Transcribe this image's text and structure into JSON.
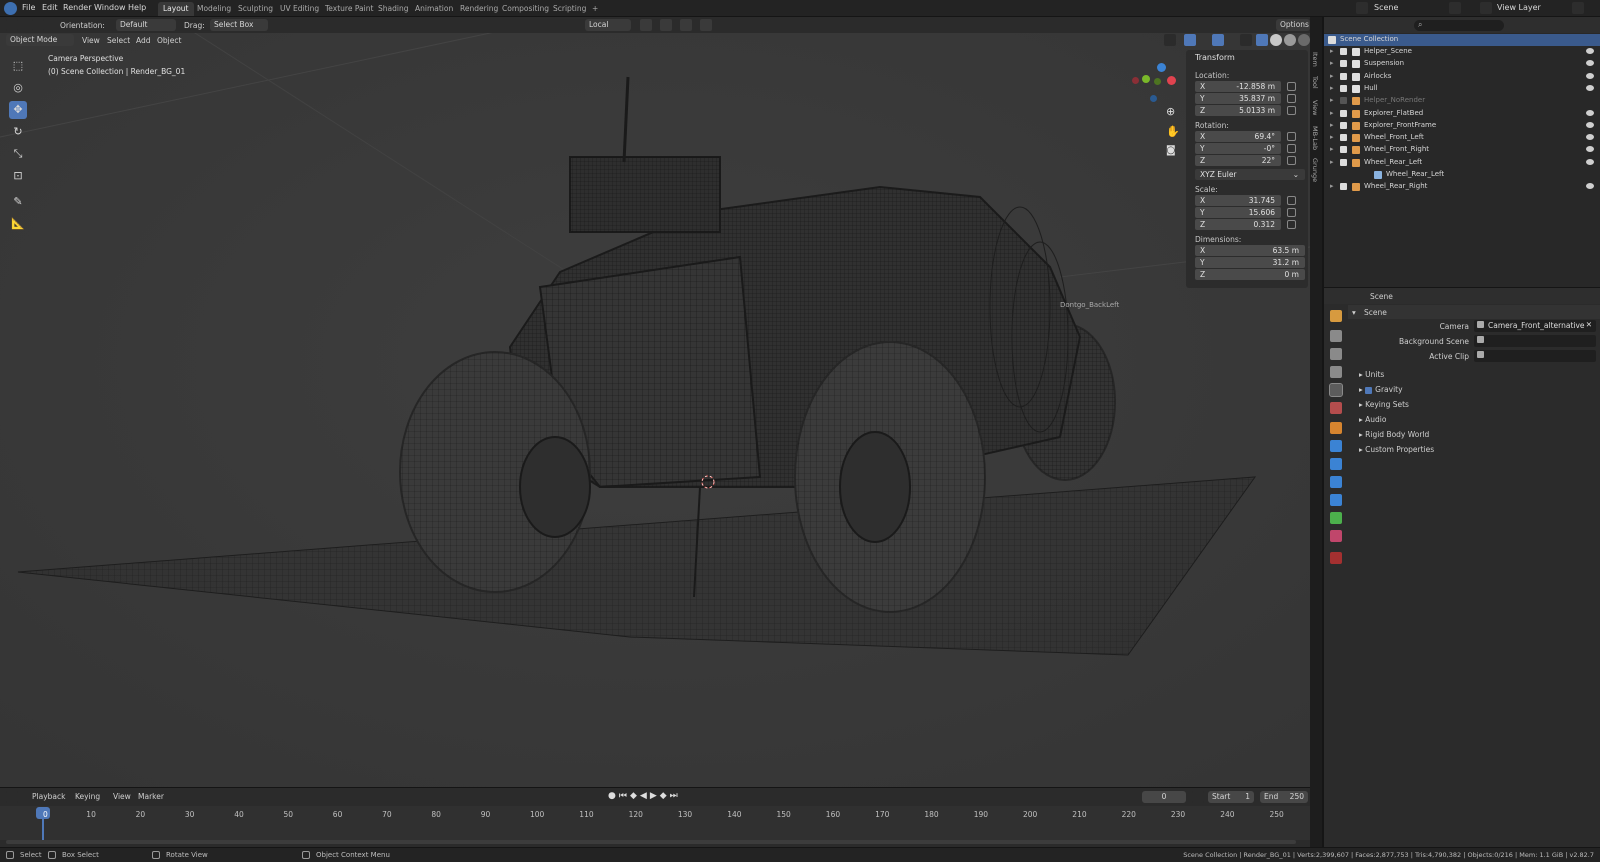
{
  "menu": {
    "items": [
      "File",
      "Edit",
      "Render",
      "Window",
      "Help"
    ],
    "workspaces": [
      "Layout",
      "Modeling",
      "Sculpting",
      "UV Editing",
      "Texture Paint",
      "Shading",
      "Animation",
      "Rendering",
      "Compositing",
      "Scripting"
    ],
    "active_workspace": "Layout",
    "add_tab": "+",
    "scene_name": "Scene",
    "view_layer": "View Layer"
  },
  "viewport_header": {
    "orientation_label": "Orientation:",
    "orientation_value": "Default",
    "drag_label": "Drag:",
    "drag_value": "Select Box",
    "transform_space": "Local",
    "options": "Options",
    "mode": "Object Mode",
    "menus": [
      "View",
      "Select",
      "Add",
      "Object"
    ]
  },
  "viewport": {
    "title": "Camera Perspective",
    "subtitle": "(0) Scene Collection | Render_BG_01",
    "overlay_label": "Dontgo_BackLeft"
  },
  "npanel": {
    "section": "Transform",
    "location_label": "Location:",
    "location": [
      {
        "axis": "X",
        "value": "-12.858 m"
      },
      {
        "axis": "Y",
        "value": "35.837 m"
      },
      {
        "axis": "Z",
        "value": "5.0133 m"
      }
    ],
    "rotation_label": "Rotation:",
    "rotation": [
      {
        "axis": "X",
        "value": "69.4°"
      },
      {
        "axis": "Y",
        "value": "-0°"
      },
      {
        "axis": "Z",
        "value": "22°"
      }
    ],
    "rotation_mode": "XYZ Euler",
    "scale_label": "Scale:",
    "scale": [
      {
        "axis": "X",
        "value": "31.745"
      },
      {
        "axis": "Y",
        "value": "15.606"
      },
      {
        "axis": "Z",
        "value": "0.312"
      }
    ],
    "dimensions_label": "Dimensions:",
    "dimensions": [
      {
        "axis": "X",
        "value": "63.5 m"
      },
      {
        "axis": "Y",
        "value": "31.2 m"
      },
      {
        "axis": "Z",
        "value": "0 m"
      }
    ],
    "tabs": [
      "Item",
      "Tool",
      "View",
      "MB-Lab",
      "Grunge"
    ]
  },
  "timeline": {
    "menus": [
      "Playback",
      "Keying",
      "View",
      "Marker"
    ],
    "current_frame": "0",
    "start_label": "Start",
    "start": "1",
    "end_label": "End",
    "end": "250",
    "ticks": [
      "0",
      "10",
      "20",
      "30",
      "40",
      "50",
      "60",
      "70",
      "80",
      "90",
      "100",
      "110",
      "120",
      "130",
      "140",
      "150",
      "160",
      "170",
      "180",
      "190",
      "200",
      "210",
      "220",
      "230",
      "240",
      "250"
    ]
  },
  "statusbar": {
    "select": "Select",
    "box_select": "Box Select",
    "rotate_view": "Rotate View",
    "context_menu": "Object Context Menu",
    "stats": "Scene Collection | Render_BG_01 | Verts:2,399,607 | Faces:2,877,753 | Tris:4,790,382 | Objects:0/216 | Mem: 1.1 GiB | v2.82.7"
  },
  "outliner": {
    "root": "Scene Collection",
    "items": [
      {
        "label": "Helper_Scene",
        "checked": true,
        "visible": true,
        "dim": false
      },
      {
        "label": "Suspension",
        "checked": true,
        "visible": true,
        "dim": false
      },
      {
        "label": "Airlocks",
        "checked": true,
        "visible": true,
        "dim": false
      },
      {
        "label": "Hull",
        "checked": true,
        "visible": true,
        "dim": false
      },
      {
        "label": "Helper_NoRender",
        "checked": false,
        "visible": false,
        "dim": true
      },
      {
        "label": "Explorer_FlatBed",
        "checked": false,
        "visible": true,
        "dim": false
      },
      {
        "label": "Explorer_FrontFrame",
        "checked": false,
        "visible": true,
        "dim": false
      },
      {
        "label": "Wheel_Front_Left",
        "checked": false,
        "visible": true,
        "dim": false
      },
      {
        "label": "Wheel_Front_Right",
        "checked": false,
        "visible": true,
        "dim": false
      },
      {
        "label": "Wheel_Rear_Left",
        "checked": false,
        "visible": true,
        "dim": false
      },
      {
        "label": "Wheel_Rear_Left",
        "checked": false,
        "visible": false,
        "dim": false,
        "child": true
      },
      {
        "label": "Wheel_Rear_Right",
        "checked": false,
        "visible": true,
        "dim": false
      }
    ]
  },
  "properties": {
    "context": "Scene",
    "panel": "Scene",
    "camera_label": "Camera",
    "camera_value": "Camera_Front_alternative",
    "background_label": "Background Scene",
    "active_clip_label": "Active Clip",
    "sections": [
      "Units",
      "Gravity",
      "Keying Sets",
      "Audio",
      "Rigid Body World",
      "Custom Properties"
    ],
    "gravity_checked": true
  },
  "colors": {
    "accent": "#4f78b8",
    "collection_icon": "#e09a4a",
    "axis_x": "#e0434f",
    "axis_y": "#7ab82a",
    "axis_z": "#3b83d4"
  }
}
